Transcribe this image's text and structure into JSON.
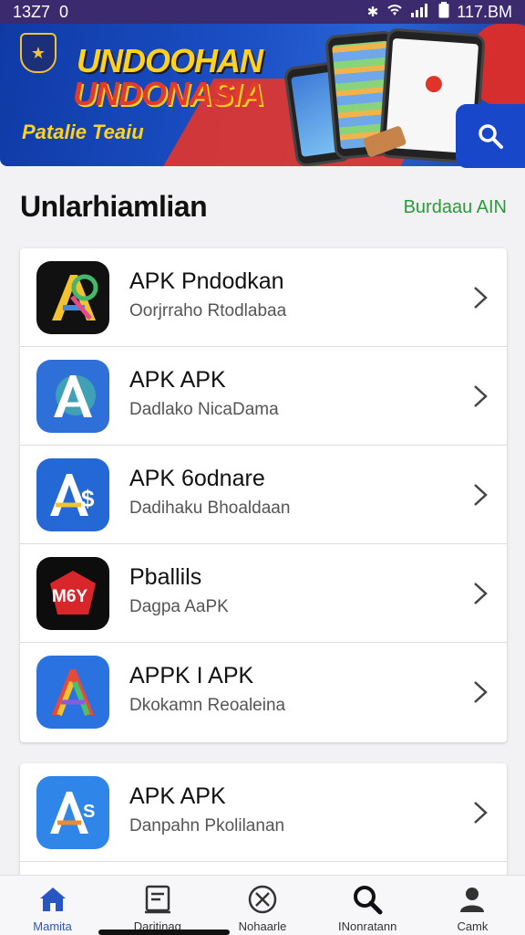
{
  "status_bar": {
    "time": "13Z7",
    "notif": "0",
    "right": "117.BM"
  },
  "banner": {
    "line1": "UNDOOHAN",
    "line2": "UNDONASIA",
    "subtitle": "Patalie Teaiu"
  },
  "section": {
    "title": "Unlarhiamlian",
    "link": "Burdaau AIN"
  },
  "apps": [
    {
      "title": "APK Pndodkan",
      "subtitle": "Oorjrraho Rtodlabaa",
      "icon": "gradient-a-icon",
      "bg": "#111111"
    },
    {
      "title": "APK APK",
      "subtitle": "Dadlako NicaDama",
      "icon": "blue-a-icon",
      "bg": "#2f6fd8"
    },
    {
      "title": "APK 6odnare",
      "subtitle": "Dadihaku Bhoaldaan",
      "icon": "blue-a-dollar-icon",
      "bg": "#2468d6"
    },
    {
      "title": "Pballils",
      "subtitle": "Dagpa AaPK",
      "icon": "m6y-icon",
      "bg": "#0d0d0d"
    },
    {
      "title": "APPK I APK",
      "subtitle": "Dkokamn Reoaleina",
      "icon": "rainbow-a-icon",
      "bg": "#2a72e0"
    }
  ],
  "apps2": [
    {
      "title": "APK APK",
      "subtitle": "Danpahn Pkolilanan",
      "icon": "blue-a-s-icon",
      "bg": "#2f86e8"
    }
  ],
  "nav": [
    {
      "label": "Mamita",
      "icon": "home-icon",
      "active": true
    },
    {
      "label": "Daritinag",
      "icon": "document-icon",
      "active": false
    },
    {
      "label": "Nohaarle",
      "icon": "circle-x-icon",
      "active": false
    },
    {
      "label": "INonratann",
      "icon": "search-icon",
      "active": false
    },
    {
      "label": "Camk",
      "icon": "profile-icon",
      "active": false
    }
  ],
  "colors": {
    "accent": "#2a56c4",
    "status_bar": "#3b2a6e",
    "link_green": "#2a9a3a",
    "banner_blue": "#1b4fc4"
  }
}
